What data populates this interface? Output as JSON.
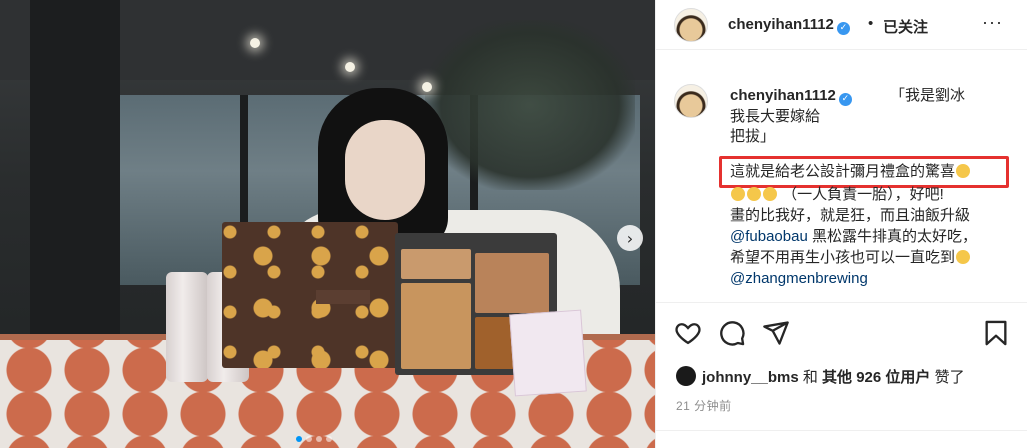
{
  "post": {
    "carousel": {
      "next_icon": "chevron-right",
      "slide_count": 4,
      "active_slide": 1
    }
  },
  "header": {
    "username": "chenyihan1112",
    "verified_icon": "verified-check",
    "separator": "•",
    "follow_status": "已关注",
    "more_icon": "more-horizontal",
    "more_glyph": "···"
  },
  "caption": {
    "username": "chenyihan1112",
    "lines": [
      "「我是劉冰",
      "我長大要嫁給",
      "把拔」",
      "這就是給老公設計彌月禮盒的驚喜",
      "（一人負責一胎），好吧!",
      "畫的比我好，就是狂，而且油飯升級",
      "黑松露牛排真的太好吃，",
      "希望不用再生小孩也可以一直吃到"
    ],
    "mentions": [
      "@fubaobau",
      "@zhangmenbrewing"
    ]
  },
  "actions": {
    "like_icon": "heart",
    "comment_icon": "comment-bubble",
    "share_icon": "paper-plane",
    "save_icon": "bookmark"
  },
  "likes": {
    "liker": "johnny__bms",
    "connector": "和",
    "others": "其他 926 位用户",
    "suffix": "赞了"
  },
  "timestamp": "21 分钟前",
  "colors": {
    "highlight_box": "#e5312f",
    "mention": "#00376b",
    "verified": "#3897f0",
    "active_dot": "#0095f6"
  }
}
